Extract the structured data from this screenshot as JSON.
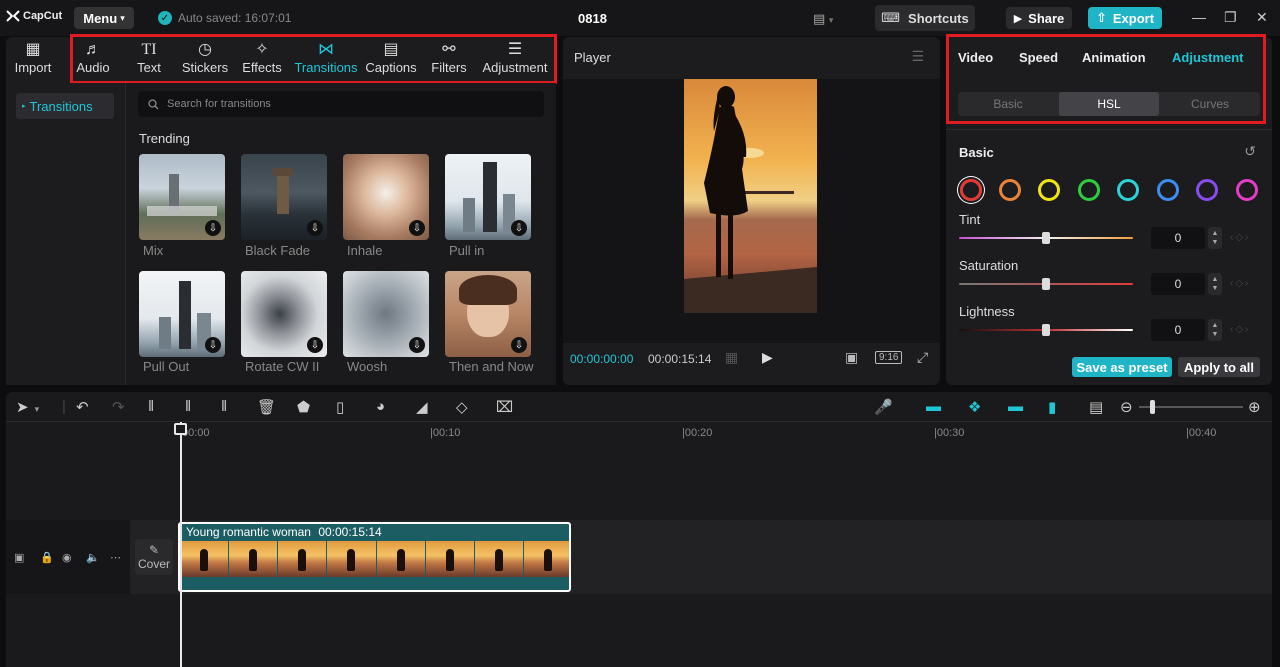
{
  "titlebar": {
    "logo": "CapCut",
    "menu_label": "Menu",
    "autosave": "Auto saved: 16:07:01",
    "project_title": "0818",
    "shortcuts_label": "Shortcuts",
    "share_label": "Share",
    "export_label": "Export"
  },
  "toptabs": [
    {
      "label": "Import",
      "icon": "import-icon"
    },
    {
      "label": "Audio",
      "icon": "audio-icon"
    },
    {
      "label": "Text",
      "icon": "text-icon"
    },
    {
      "label": "Stickers",
      "icon": "stickers-icon"
    },
    {
      "label": "Effects",
      "icon": "effects-icon"
    },
    {
      "label": "Transitions",
      "icon": "transitions-icon"
    },
    {
      "label": "Captions",
      "icon": "captions-icon"
    },
    {
      "label": "Filters",
      "icon": "filters-icon"
    },
    {
      "label": "Adjustment",
      "icon": "adjustment-icon"
    }
  ],
  "sidebar": {
    "active_item": "Transitions"
  },
  "search": {
    "placeholder": "Search for transitions"
  },
  "trending": {
    "title": "Trending",
    "items": [
      "Mix",
      "Black Fade",
      "Inhale",
      "Pull in",
      "Pull Out",
      "Rotate CW II",
      "Woosh",
      "Then and Now"
    ]
  },
  "player": {
    "title": "Player",
    "current_time": "00:00:00:00",
    "total_time": "00:00:15:14",
    "ratio": "9:16"
  },
  "right": {
    "tabs": [
      "Video",
      "Speed",
      "Animation",
      "Adjustment"
    ],
    "subtabs": [
      "Basic",
      "HSL",
      "Curves"
    ],
    "section_title": "Basic",
    "colors": [
      "#e53935",
      "#e8833a",
      "#f2e411",
      "#2ecc40",
      "#2bd2d8",
      "#3d8ef0",
      "#8a4cf0",
      "#e63cc8"
    ],
    "sliders": [
      {
        "label": "Tint",
        "value": "0"
      },
      {
        "label": "Saturation",
        "value": "0"
      },
      {
        "label": "Lightness",
        "value": "0"
      }
    ],
    "save_preset_label": "Save as preset",
    "apply_all_label": "Apply to all"
  },
  "timeline": {
    "ruler": [
      "00:00",
      "00:10",
      "00:20",
      "00:30",
      "00:40"
    ],
    "clip_name": "Young romantic woman",
    "clip_duration": "00:00:15:14",
    "cover_label": "Cover"
  }
}
